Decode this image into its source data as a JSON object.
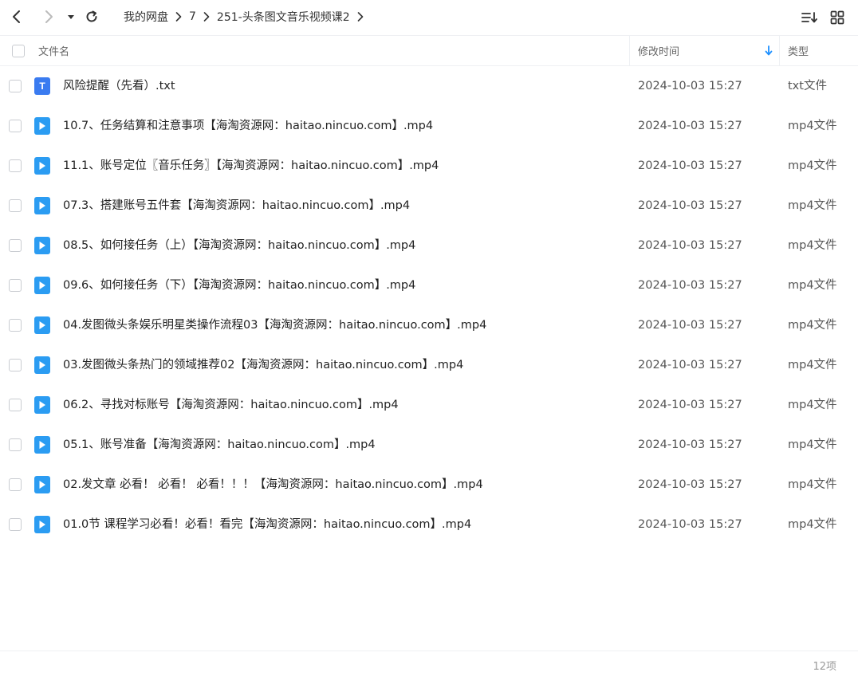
{
  "toolbar": {
    "back_icon": "chevron-left-icon",
    "forward_icon": "chevron-right-icon",
    "dropdown_icon": "caret-down-icon",
    "refresh_icon": "refresh-icon",
    "sort_icon": "sort-list-icon",
    "grid_icon": "grid-view-icon"
  },
  "breadcrumb": [
    "我的网盘",
    "7",
    "251-头条图文音乐视频课2"
  ],
  "columns": {
    "name": "文件名",
    "modified": "修改时间",
    "type": "类型",
    "sort_direction": "descending"
  },
  "files": [
    {
      "name": "风险提醒（先看）.txt",
      "modified": "2024-10-03 15:27",
      "type": "txt文件",
      "kind": "txt",
      "icon_letter": "T"
    },
    {
      "name": "10.7、任务结算和注意事项【海淘资源网：haitao.nincuo.com】.mp4",
      "modified": "2024-10-03 15:27",
      "type": "mp4文件",
      "kind": "video"
    },
    {
      "name": "11.1、账号定位〖音乐任务〗【海淘资源网：haitao.nincuo.com】.mp4",
      "modified": "2024-10-03 15:27",
      "type": "mp4文件",
      "kind": "video"
    },
    {
      "name": "07.3、搭建账号五件套【海淘资源网：haitao.nincuo.com】.mp4",
      "modified": "2024-10-03 15:27",
      "type": "mp4文件",
      "kind": "video"
    },
    {
      "name": "08.5、如何接任务（上）【海淘资源网：haitao.nincuo.com】.mp4",
      "modified": "2024-10-03 15:27",
      "type": "mp4文件",
      "kind": "video"
    },
    {
      "name": "09.6、如何接任务（下）【海淘资源网：haitao.nincuo.com】.mp4",
      "modified": "2024-10-03 15:27",
      "type": "mp4文件",
      "kind": "video"
    },
    {
      "name": "04.发图微头条娱乐明星类操作流程03【海淘资源网：haitao.nincuo.com】.mp4",
      "modified": "2024-10-03 15:27",
      "type": "mp4文件",
      "kind": "video"
    },
    {
      "name": "03.发图微头条热门的领域推荐02【海淘资源网：haitao.nincuo.com】.mp4",
      "modified": "2024-10-03 15:27",
      "type": "mp4文件",
      "kind": "video"
    },
    {
      "name": "06.2、寻找对标账号【海淘资源网：haitao.nincuo.com】.mp4",
      "modified": "2024-10-03 15:27",
      "type": "mp4文件",
      "kind": "video"
    },
    {
      "name": "05.1、账号准备【海淘资源网：haitao.nincuo.com】.mp4",
      "modified": "2024-10-03 15:27",
      "type": "mp4文件",
      "kind": "video"
    },
    {
      "name": "02.发文章 必看！ 必看！ 必看！！！【海淘资源网：haitao.nincuo.com】.mp4",
      "modified": "2024-10-03 15:27",
      "type": "mp4文件",
      "kind": "video"
    },
    {
      "name": "01.0节 课程学习必看！必看！看完【海淘资源网：haitao.nincuo.com】.mp4",
      "modified": "2024-10-03 15:27",
      "type": "mp4文件",
      "kind": "video"
    }
  ],
  "footer": {
    "count": "12项"
  },
  "colors": {
    "accent": "#1e90ff",
    "txt_icon": "#3a7bf0",
    "video_icon": "#2b9cf2",
    "divider": "#eef0f3"
  }
}
